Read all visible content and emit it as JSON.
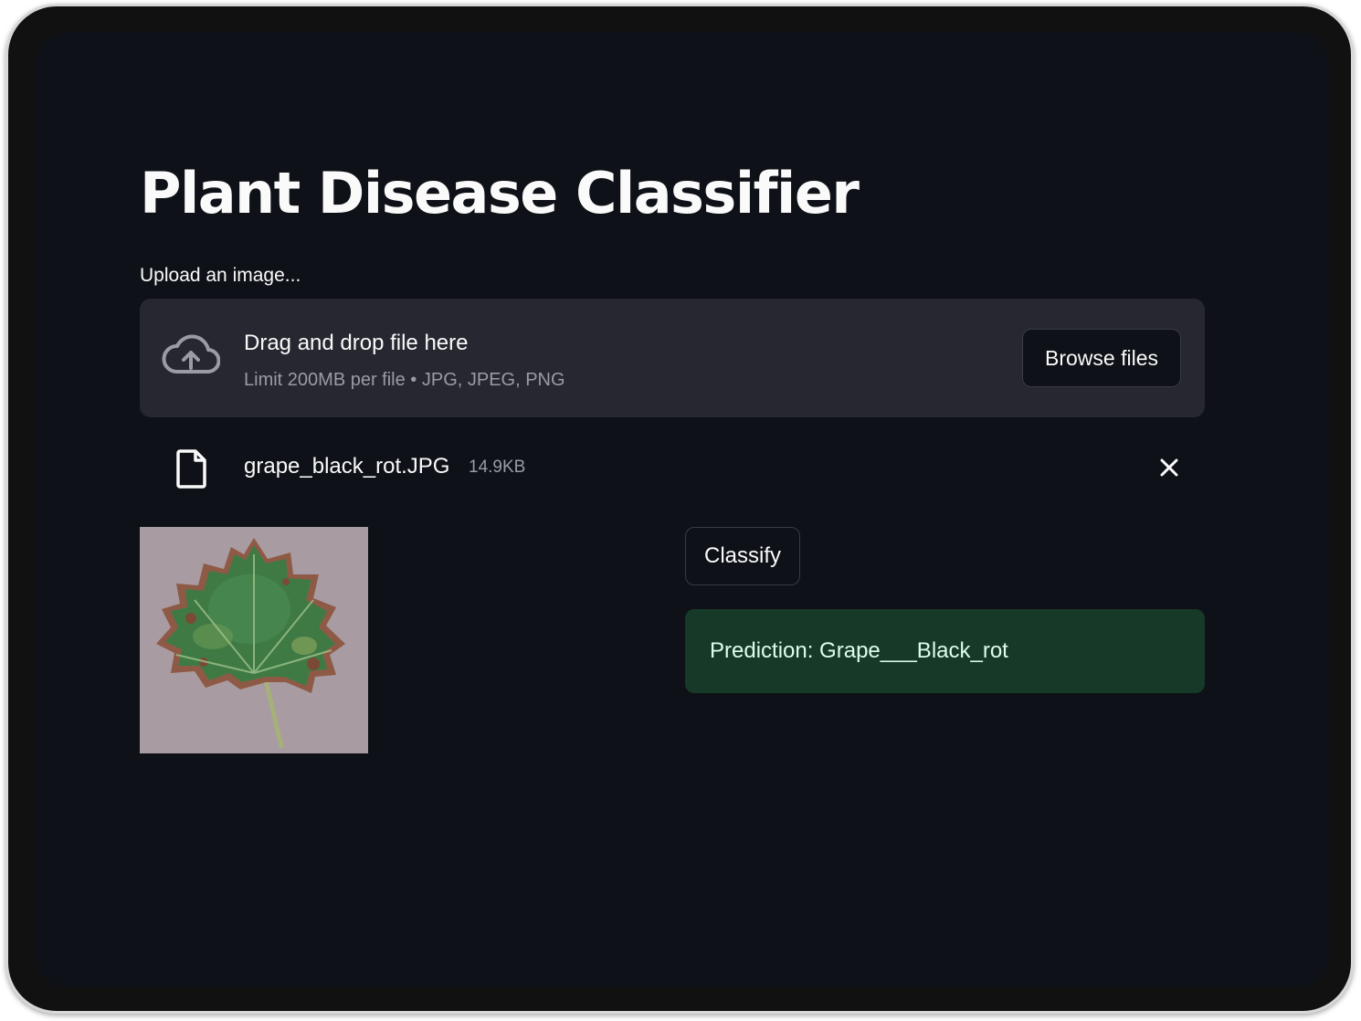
{
  "app": {
    "title": "Plant Disease Classifier"
  },
  "uploader": {
    "label": "Upload an image...",
    "icon": "cloud-upload-icon",
    "drag_text": "Drag and drop file here",
    "limit_text": "Limit 200MB per file • JPG, JPEG, PNG",
    "browse_label": "Browse files"
  },
  "uploaded_file": {
    "icon": "file-icon",
    "name": "grape_black_rot.JPG",
    "size": "14.9KB",
    "remove_icon": "close-icon"
  },
  "actions": {
    "classify_label": "Classify"
  },
  "result": {
    "prediction_text": "Prediction: Grape___Black_rot"
  },
  "colors": {
    "background": "#0e1117",
    "dropzone": "#262730",
    "success_bg": "#173928",
    "success_text": "#dffde9",
    "text": "#fafafa",
    "muted_text": "#9a9ba3"
  }
}
